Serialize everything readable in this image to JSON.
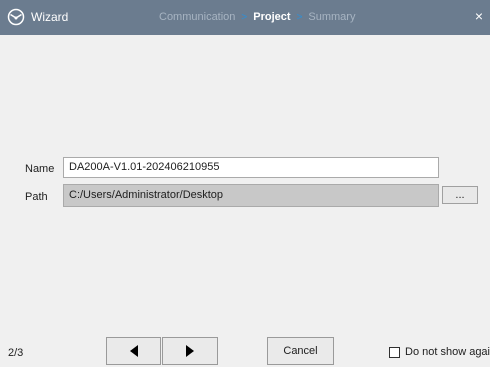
{
  "window": {
    "title": "Wizard",
    "icon": "wizard-app-icon",
    "close_icon": "×"
  },
  "steps": [
    {
      "label": "Communication",
      "active": false
    },
    {
      "label": "Project",
      "active": true
    },
    {
      "label": "Summary",
      "active": false
    }
  ],
  "step_separator": ">",
  "form": {
    "name_label": "Name",
    "name_value": "DA200A-V1.01-202406210955",
    "path_label": "Path",
    "path_value": "C:/Users/Administrator/Desktop",
    "browse_label": "..."
  },
  "footer": {
    "page_indicator": "2/3",
    "cancel_label": "Cancel",
    "dont_show_label": "Do not show again",
    "dont_show_checked": false
  },
  "colors": {
    "titlebar": "#6b7c8f",
    "step_arrow": "#2f8fd6",
    "path_background": "#c8c8c8"
  }
}
